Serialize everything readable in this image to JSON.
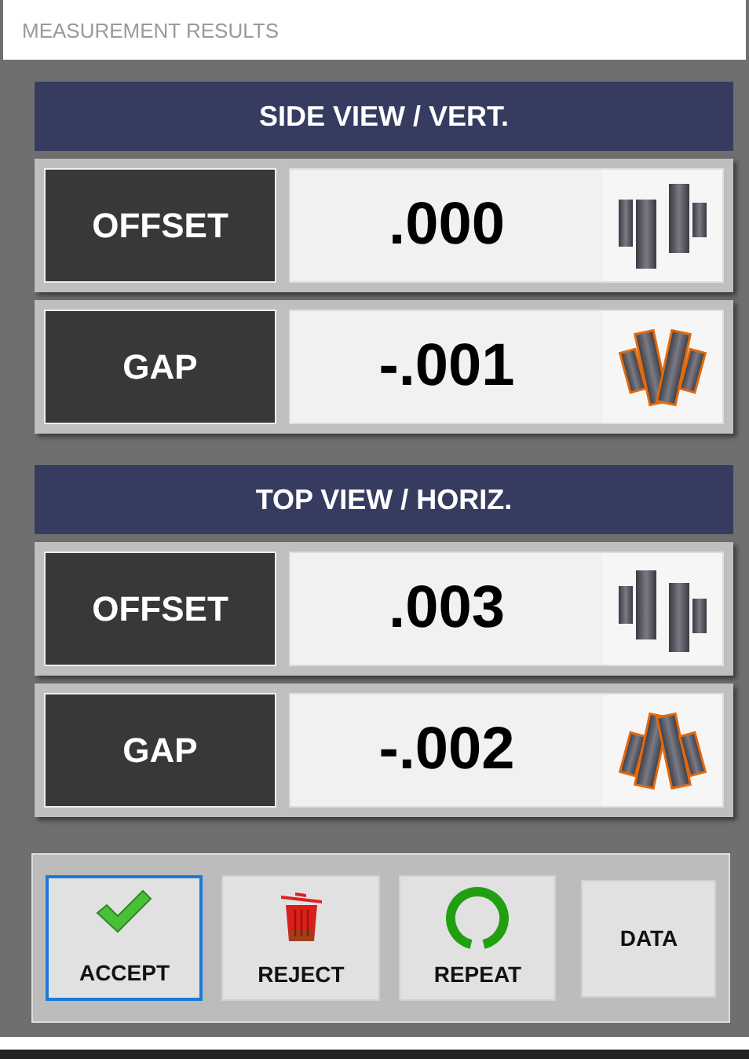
{
  "window": {
    "title": "MEASUREMENT RESULTS"
  },
  "sections": [
    {
      "title": "SIDE VIEW / VERT.",
      "rows": [
        {
          "label": "OFFSET",
          "value": ".000",
          "kind": "offset-rise"
        },
        {
          "label": "GAP",
          "value": "-.001",
          "kind": "gap-open-top"
        }
      ]
    },
    {
      "title": "TOP VIEW / HORIZ.",
      "rows": [
        {
          "label": "OFFSET",
          "value": ".003",
          "kind": "offset-drop"
        },
        {
          "label": "GAP",
          "value": "-.002",
          "kind": "gap-open-bottom"
        }
      ]
    }
  ],
  "buttons": [
    {
      "label": "ACCEPT",
      "kind": "check",
      "selected": true
    },
    {
      "label": "REJECT",
      "kind": "trash",
      "selected": false
    },
    {
      "label": "REPEAT",
      "kind": "repeat",
      "selected": false
    },
    {
      "label": "DATA",
      "kind": "text",
      "selected": false
    }
  ]
}
